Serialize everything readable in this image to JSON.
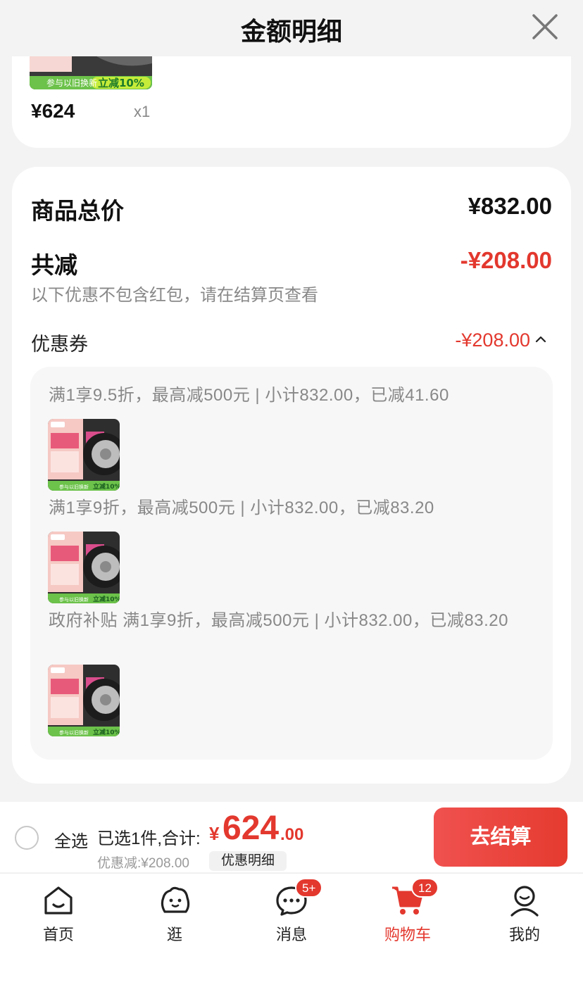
{
  "header": {
    "title": "金额明细"
  },
  "product": {
    "price": "¥624",
    "qty": "x1",
    "thumb_banner_left": "参与以旧换新",
    "thumb_banner_right": "立减10%"
  },
  "summary": {
    "total_label": "商品总价",
    "total_value": "¥832.00",
    "reduce_label": "共减",
    "reduce_value": "-¥208.00",
    "note": "以下优惠不包含红包，请在结算页查看",
    "coupon_label": "优惠券",
    "coupon_value": "-¥208.00"
  },
  "coupons": [
    {
      "text": "满1享9.5折，最高减500元 | 小计832.00，已减41.60"
    },
    {
      "text": "满1享9折，最高减500元 | 小计832.00，已减83.20"
    },
    {
      "text": "政府补贴 满1享9折，最高减500元 | 小计832.00，已减83.20"
    }
  ],
  "coupon_thumb": {
    "banner_left": "参与以旧换新",
    "banner_right": "立减10%"
  },
  "checkout": {
    "select_all": "全选",
    "selected_info": "已选1件,合计:",
    "yen": "¥",
    "total_int": "624",
    "total_dec": ".00",
    "discount": "优惠减:¥208.00",
    "detail_chip": "优惠明细",
    "button": "去结算"
  },
  "tabs": [
    {
      "label": "首页",
      "icon": "home-icon"
    },
    {
      "label": "逛",
      "icon": "discover-icon"
    },
    {
      "label": "消息",
      "icon": "message-icon",
      "badge": "5+"
    },
    {
      "label": "购物车",
      "icon": "cart-icon",
      "badge": "12",
      "active": true
    },
    {
      "label": "我的",
      "icon": "profile-icon"
    }
  ],
  "colors": {
    "accent": "#e3382e",
    "background": "#f3f3f3",
    "muted": "#888888"
  }
}
